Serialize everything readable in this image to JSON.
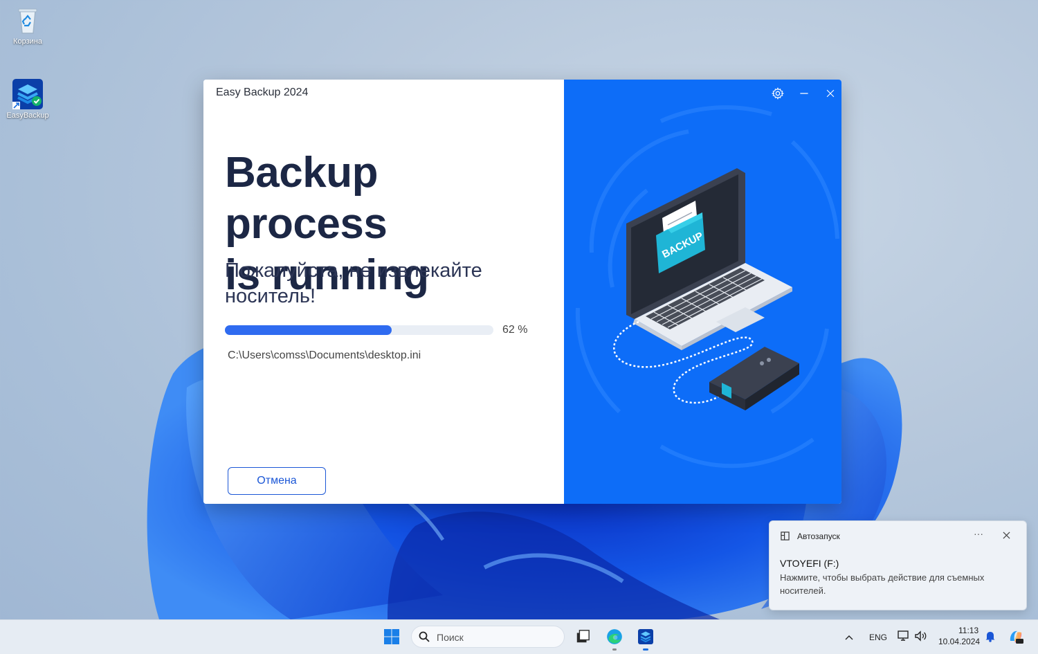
{
  "desktop": {
    "icons": [
      {
        "label": "Корзина"
      },
      {
        "label": "EasyBackup"
      }
    ]
  },
  "app": {
    "title": "Easy Backup 2024",
    "headline_line1": "Backup process",
    "headline_line2": "is running",
    "subtitle": "Пожалуйста, не извлекайте носитель!",
    "progress": {
      "percent": 62,
      "label": "62 %"
    },
    "current_file": "C:\\Users\\comss\\Documents\\desktop.ini",
    "cancel_label": "Отмена",
    "illustration_text": "BACKUP",
    "accent_color": "#0d6df8"
  },
  "toast": {
    "app_name": "Автозапуск",
    "device": "VTOYEFI (F:)",
    "message": "Нажмите, чтобы выбрать действие для съемных носителей."
  },
  "taskbar": {
    "search_placeholder": "Поиск",
    "language": "ENG",
    "time": "11:13",
    "date": "10.04.2024"
  }
}
